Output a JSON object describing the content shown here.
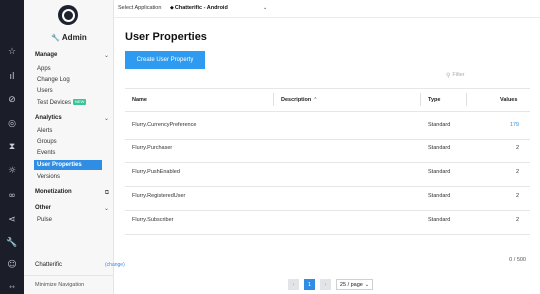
{
  "top_bar": {
    "select_label": "Select Application",
    "app_name": "Chatterific - Android",
    "app_glyph": "◆",
    "dropdown_glyph": "⌄"
  },
  "rail_icons": [
    {
      "name": "star-icon",
      "glyph": "☆"
    },
    {
      "name": "analytics-bars-icon",
      "glyph": "ıl"
    },
    {
      "name": "no-entry-icon",
      "glyph": "⊘"
    },
    {
      "name": "target-icon",
      "glyph": "◎"
    },
    {
      "name": "hourglass-icon",
      "glyph": "⧗"
    },
    {
      "name": "sun-icon",
      "glyph": "☼"
    },
    {
      "name": "infinity-icon",
      "glyph": "∞"
    },
    {
      "name": "share-icon",
      "glyph": "⋖"
    },
    {
      "name": "wrench-icon",
      "glyph": "🔧"
    },
    {
      "name": "user-circle-icon",
      "glyph": "☺"
    },
    {
      "name": "collapse-arrows-icon",
      "glyph": "↔"
    }
  ],
  "sidebar": {
    "admin_label": "Admin",
    "admin_icon": "🔧",
    "sections": [
      {
        "label": "Manage",
        "chevron": "⌄",
        "items": [
          "Apps",
          "Change Log",
          "Users",
          "Test Devices"
        ],
        "badge": "NEW"
      },
      {
        "label": "Analytics",
        "chevron": "⌄",
        "items": [
          "Alerts",
          "Groups",
          "Events",
          "User Properties",
          "Versions"
        ]
      },
      {
        "label": "Monetization",
        "chevron": "⧉",
        "items": []
      },
      {
        "label": "Other",
        "chevron": "⌄",
        "items": [
          "Pulse"
        ]
      }
    ],
    "selected_item": "User Properties",
    "footer_app": "Chatterific",
    "footer_change": "(change)",
    "minimize": "Minimize Navigation"
  },
  "main": {
    "title": "User Properties",
    "create_button": "Create User Property",
    "filter_placeholder": "Filter",
    "filter_icon": "search-icon",
    "columns": {
      "name": "Name",
      "description": "Description",
      "sort_glyph": "⌃",
      "type": "Type",
      "values": "Values"
    },
    "rows": [
      {
        "name": "Flurry.CurrencyPreference",
        "description": "",
        "type": "Standard",
        "values": "179",
        "values_is_link": true
      },
      {
        "name": "Flurry.Purchaser",
        "description": "",
        "type": "Standard",
        "values": "2",
        "values_is_link": false
      },
      {
        "name": "Flurry.PushEnabled",
        "description": "",
        "type": "Standard",
        "values": "2",
        "values_is_link": false
      },
      {
        "name": "Flurry.RegisteredUser",
        "description": "",
        "type": "Standard",
        "values": "2",
        "values_is_link": false
      },
      {
        "name": "Flurry.Subscriber",
        "description": "",
        "type": "Standard",
        "values": "2",
        "values_is_link": false
      }
    ],
    "count": "0 / 500",
    "pagination": {
      "prev": "‹",
      "current": "1",
      "next": "›",
      "page_size": "25 / page",
      "page_size_chevron": "⌄"
    }
  },
  "colors": {
    "accent": "#2f8de4",
    "button": "#2f9bf0",
    "rail_bg": "#1b1e29",
    "badge": "#3bc49a"
  }
}
